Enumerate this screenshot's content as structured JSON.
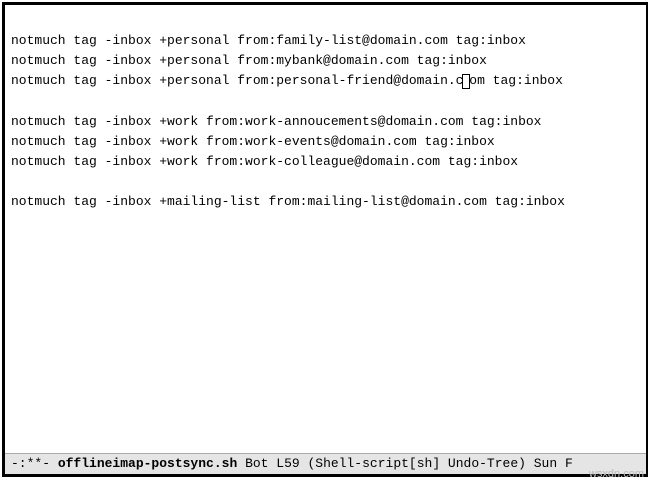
{
  "buffer": {
    "groups": [
      {
        "lines": [
          "notmuch tag -inbox +personal from:family-list@domain.com tag:inbox",
          "notmuch tag -inbox +personal from:mybank@domain.com tag:inbox",
          "notmuch tag -inbox +personal from:personal-friend@domain.com tag:inbox"
        ]
      },
      {
        "lines": [
          "notmuch tag -inbox +work from:work-annoucements@domain.com tag:inbox",
          "notmuch tag -inbox +work from:work-events@domain.com tag:inbox",
          "notmuch tag -inbox +work from:work-colleague@domain.com tag:inbox"
        ]
      },
      {
        "lines": [
          "notmuch tag -inbox +mailing-list from:mailing-list@domain.com tag:inbox"
        ]
      }
    ],
    "cursor": {
      "group": 0,
      "line": 2,
      "col": 58
    }
  },
  "modeline": {
    "prefix": "-:**-  ",
    "filename": "offlineimap-postsync.sh",
    "spacer": "   ",
    "position": "Bot",
    "line_indicator": "L59",
    "modes": "(Shell-script[sh] Undo-Tree)",
    "tail": "Sun F"
  },
  "watermark": "wsxdn.com"
}
